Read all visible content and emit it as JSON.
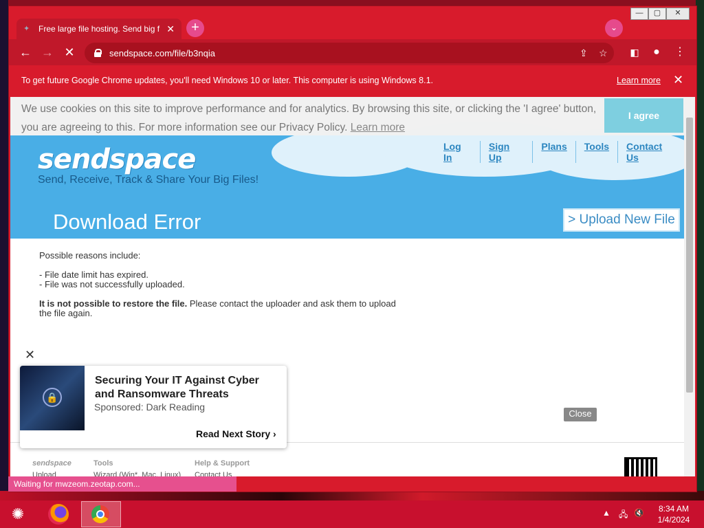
{
  "browser": {
    "tab_title": "Free large file hosting. Send big f",
    "url": "sendspace.com/file/b3nqia",
    "infobar_message": "To get future Google Chrome updates, you'll need Windows 10 or later. This computer is using Windows 8.1.",
    "infobar_learn_more": "Learn more",
    "status_text": "Waiting for mwzeom.zeotap.com..."
  },
  "cookie": {
    "text": "We use cookies on this site to improve performance and for analytics. By browsing this site, or clicking the 'I agree' button, you are agreeing to this. For more information see our Privacy Policy.",
    "learn_more": "Learn more",
    "agree": "I agree"
  },
  "site": {
    "logo": "sendspace",
    "tagline": "Send, Receive, Track & Share Your Big Files!",
    "nav": [
      "Log In",
      "Sign Up",
      "Plans",
      "Tools",
      "Contact Us"
    ],
    "page_title": "Download Error",
    "upload_button": "> Upload New File"
  },
  "content": {
    "intro": "Possible reasons include:",
    "reason1": "- File date limit has expired.",
    "reason2": "- File was not successfully uploaded.",
    "restore_bold": "It is not possible to restore the file.",
    "restore_rest": " Please contact the uploader and ask them to upload the file again.",
    "close_label": "Close"
  },
  "footer": {
    "col1_head": "sendspace",
    "col1_link": "Upload",
    "col2_head": "Tools",
    "col2_link": "Wizard (Win*, Mac, Linux)",
    "col3_head": "Help & Support",
    "col3_link": "Contact Us"
  },
  "ad": {
    "title": "Securing Your IT Against Cyber and Ransomware Threats",
    "sponsor": "Sponsored: Dark Reading",
    "next": "Read Next Story"
  },
  "taskbar": {
    "time": "8:34 AM",
    "date": "1/4/2024"
  },
  "colors": {
    "chrome_theme": "#d81b2c",
    "site_blue": "#49aee6",
    "status_pink": "#e6508e"
  }
}
